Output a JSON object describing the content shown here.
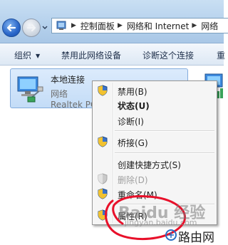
{
  "address_bar": {
    "breadcrumbs": [
      "控制面板",
      "网络和 Internet",
      "网络"
    ]
  },
  "toolbar": {
    "organize_label": "组织",
    "disable_label": "禁用此网络设备",
    "diagnose_label": "诊断这个连接",
    "rename_label": "重"
  },
  "connection": {
    "name": "本地连接",
    "status": "网络",
    "device": "Realtek PC"
  },
  "context_menu": {
    "items": [
      {
        "label": "禁用(B)",
        "icon": "shield-icon",
        "style": "normal"
      },
      {
        "label": "状态(U)",
        "icon": "",
        "style": "bold"
      },
      {
        "label": "诊断(I)",
        "icon": "",
        "style": "normal"
      },
      {
        "label": "桥接(G)",
        "icon": "shield-icon",
        "style": "normal"
      },
      {
        "label": "创建快捷方式(S)",
        "icon": "",
        "style": "normal"
      },
      {
        "label": "删除(D)",
        "icon": "shield-icon",
        "style": "disabled"
      },
      {
        "label": "重命名(M)",
        "icon": "shield-icon",
        "style": "normal"
      },
      {
        "label": "属性(R)",
        "icon": "shield-icon",
        "style": "normal"
      }
    ]
  },
  "watermark": {
    "brand": "Baidu 经验",
    "url": "jingyan.baidu.com",
    "router": "路由网"
  },
  "colors": {
    "title_gradient_top": "#c9dff3",
    "selection_blue": "#c3dcf7",
    "annotation_red": "#e8102a"
  }
}
